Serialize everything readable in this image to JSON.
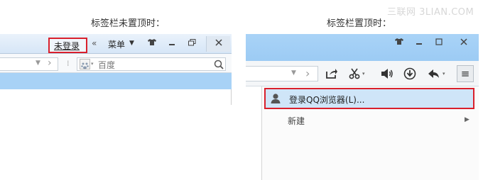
{
  "captions": {
    "left": "标签栏未置顶时：",
    "right": "标签栏置顶时："
  },
  "watermark": "三联网 3LIAN.COM",
  "left_browser": {
    "unlogged_label": "未登录",
    "collapse_glyph": "«",
    "menu_label": "菜单",
    "search_placeholder": "百度",
    "icons": [
      "shirt-icon",
      "minimize-icon",
      "restore-icon",
      "close-icon",
      "dropdown-arrow-icon",
      "forward-icon",
      "baidu-paw-icon",
      "search-icon"
    ]
  },
  "right_browser": {
    "icons": [
      "shirt-icon",
      "minimize-icon",
      "restore-icon",
      "close-icon",
      "dropdown-arrow-icon",
      "forward-icon",
      "share-icon",
      "scissors-icon",
      "speaker-icon",
      "download-icon",
      "undo-icon",
      "menu-icon"
    ],
    "menu": {
      "items": [
        {
          "label": "登录QQ浏览器(L)...",
          "icon": "user-icon",
          "highlighted": true
        },
        {
          "label": "新建",
          "submenu": true
        }
      ]
    }
  },
  "colors": {
    "highlight_border": "#d9202c",
    "tab_strip_blue": "#a8d2f6",
    "menu_highlight": "#cfe5f8"
  }
}
